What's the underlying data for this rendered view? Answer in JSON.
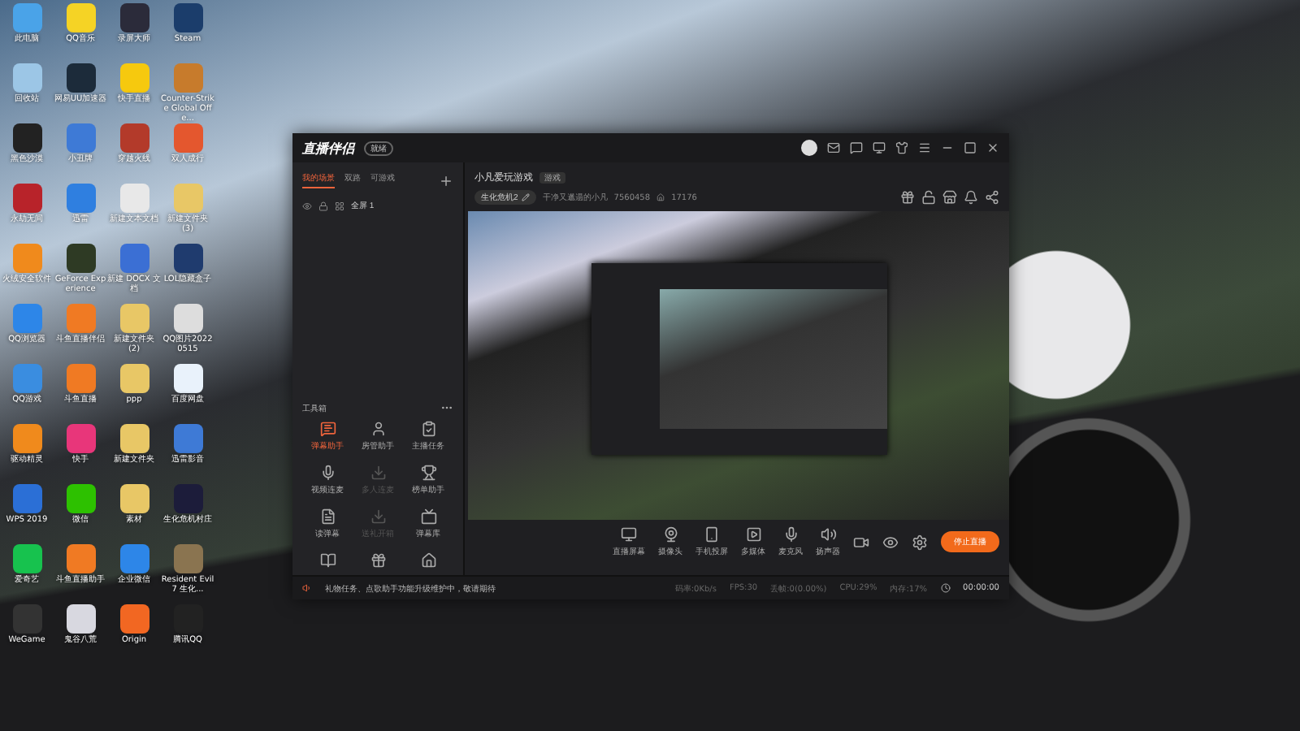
{
  "desktop_icons": [
    {
      "label": "此电脑",
      "color": "#4aa3e8"
    },
    {
      "label": "QQ音乐",
      "color": "#f5d325"
    },
    {
      "label": "录屏大师",
      "color": "#2b2b3a"
    },
    {
      "label": "Steam",
      "color": "#1b3d6b"
    },
    {
      "label": "回收站",
      "color": "#9cc6e6"
    },
    {
      "label": "网易UU加速器",
      "color": "#1c2b3a"
    },
    {
      "label": "快手直播",
      "color": "#f6c90e"
    },
    {
      "label": "Counter-Strike Global Offe...",
      "color": "#c77b2c"
    },
    {
      "label": "黑色沙漠",
      "color": "#222222"
    },
    {
      "label": "小丑牌",
      "color": "#3e7ad6"
    },
    {
      "label": "穿越火线",
      "color": "#b33a2a"
    },
    {
      "label": "双人成行",
      "color": "#e4572e"
    },
    {
      "label": "永劫无间",
      "color": "#b8232a"
    },
    {
      "label": "迅雷",
      "color": "#2f7fe0"
    },
    {
      "label": "新建文本文档",
      "color": "#e8e8e8"
    },
    {
      "label": "新建文件夹 (3)",
      "color": "#e8c766"
    },
    {
      "label": "火绒安全软件",
      "color": "#f08a1c"
    },
    {
      "label": "GeForce Experience",
      "color": "#2e3a24"
    },
    {
      "label": "新建 DOCX 文档",
      "color": "#3b6fd4"
    },
    {
      "label": "LOL隐藏盒子",
      "color": "#1f3b6e"
    },
    {
      "label": "QQ浏览器",
      "color": "#2d86e8"
    },
    {
      "label": "斗鱼直播伴侣",
      "color": "#f07a23"
    },
    {
      "label": "新建文件夹 (2)",
      "color": "#e8c766"
    },
    {
      "label": "QQ图片20220515",
      "color": "#dddddd"
    },
    {
      "label": "QQ游戏",
      "color": "#3a8de0"
    },
    {
      "label": "斗鱼直播",
      "color": "#f07a23"
    },
    {
      "label": "ppp",
      "color": "#e8c766"
    },
    {
      "label": "百度网盘",
      "color": "#e9f2fb"
    },
    {
      "label": "驱动精灵",
      "color": "#f08a1c"
    },
    {
      "label": "快手",
      "color": "#e8367a"
    },
    {
      "label": "新建文件夹",
      "color": "#e8c766"
    },
    {
      "label": "迅雷影音",
      "color": "#3e7ad6"
    },
    {
      "label": "WPS 2019",
      "color": "#2b6fd6"
    },
    {
      "label": "微信",
      "color": "#2dc100"
    },
    {
      "label": "素材",
      "color": "#e8c766"
    },
    {
      "label": "生化危机村庄",
      "color": "#1c1c3a"
    },
    {
      "label": "爱奇艺",
      "color": "#17c24e"
    },
    {
      "label": "斗鱼直播助手",
      "color": "#f07a23"
    },
    {
      "label": "企业微信",
      "color": "#2d86e8"
    },
    {
      "label": "Resident Evil 7 生化...",
      "color": "#8a7450"
    },
    {
      "label": "WeGame",
      "color": "#333333"
    },
    {
      "label": "鬼谷八荒",
      "color": "#d8d8e0"
    },
    {
      "label": "Origin",
      "color": "#f26722"
    },
    {
      "label": "腾讯QQ",
      "color": "#222222"
    }
  ],
  "app": {
    "logo": "直播伴侣",
    "version_badge": "就绪",
    "scene_tabs": [
      {
        "label": "我的场景",
        "selected": true
      },
      {
        "label": "双路",
        "selected": false
      },
      {
        "label": "可游戏",
        "selected": false
      }
    ],
    "scenes": [
      {
        "label": "全屏 1"
      }
    ],
    "stream": {
      "title": "小凡爱玩游戏",
      "category": "游戏",
      "game": "生化危机2",
      "streamer": "干净又邋遢的小凡",
      "room_id": "7560458",
      "popularity": "17176"
    },
    "toolbox": {
      "title": "工具箱",
      "tools": [
        {
          "label": "弹幕助手",
          "active": true,
          "disabled": false
        },
        {
          "label": "房管助手",
          "active": false,
          "disabled": false
        },
        {
          "label": "主播任务",
          "active": false,
          "disabled": false
        },
        {
          "label": "视频连麦",
          "active": false,
          "disabled": false
        },
        {
          "label": "多人连麦",
          "active": false,
          "disabled": true
        },
        {
          "label": "榜单助手",
          "active": false,
          "disabled": false
        },
        {
          "label": "读弹幕",
          "active": false,
          "disabled": false
        },
        {
          "label": "送礼开箱",
          "active": false,
          "disabled": true
        },
        {
          "label": "弹幕库",
          "active": false,
          "disabled": false
        },
        {
          "active": false,
          "disabled": false
        },
        {
          "active": false,
          "disabled": false
        },
        {
          "active": false,
          "disabled": false
        }
      ]
    },
    "notice": "礼物任务、点歌助手功能升级维护中，敬请期待",
    "controls": [
      {
        "label": "直播屏幕"
      },
      {
        "label": "摄像头"
      },
      {
        "label": "手机投屏"
      },
      {
        "label": "多媒体"
      },
      {
        "label": "麦克风"
      },
      {
        "label": "扬声器"
      }
    ],
    "live_button": "停止直播",
    "status": [
      "码率:0Kb/s",
      "FPS:30",
      "丢帧:0(0.00%)",
      "CPU:29%",
      "内存:17%"
    ],
    "timer": "00:00:00"
  }
}
